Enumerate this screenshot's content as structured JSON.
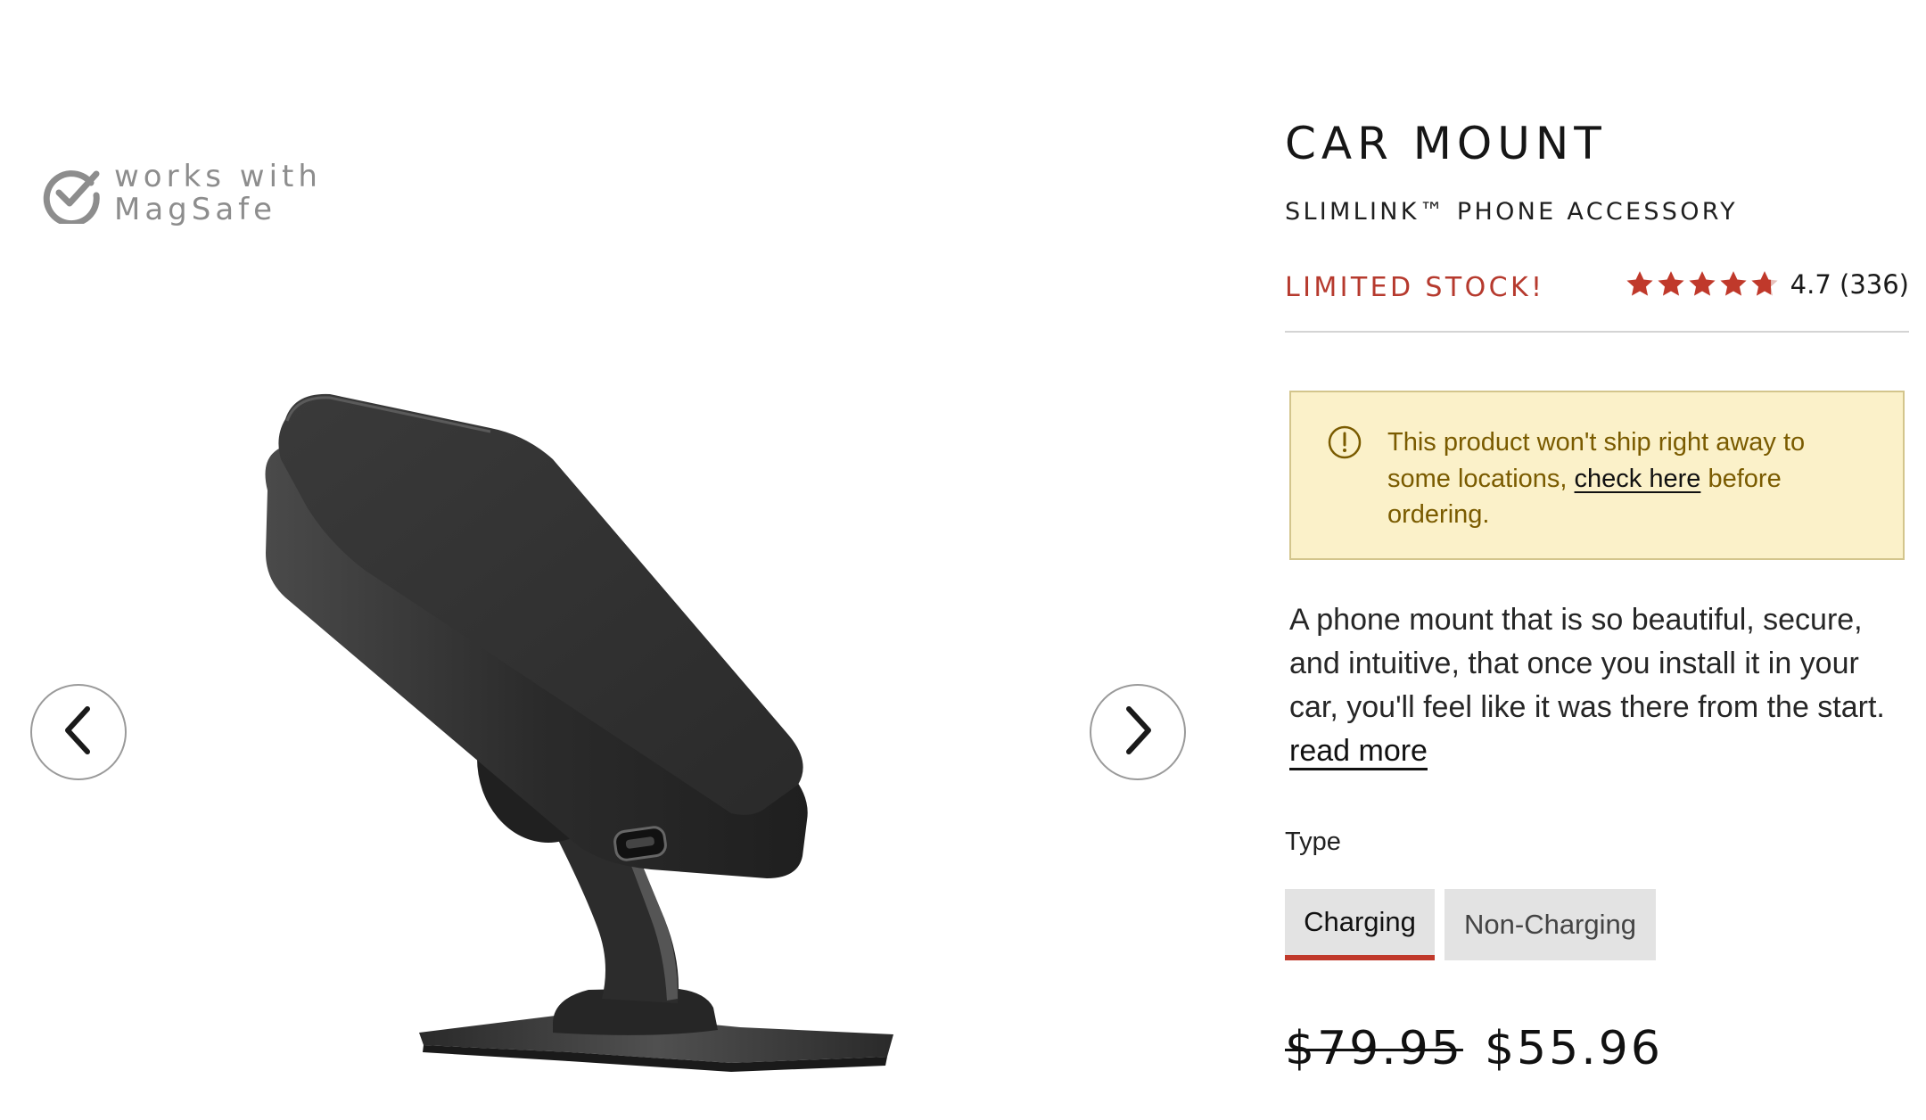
{
  "badge": {
    "line1": "works with",
    "line2": "MagSafe",
    "icon": "check-circle-icon"
  },
  "gallery": {
    "prev_icon": "chevron-left-icon",
    "next_icon": "chevron-right-icon",
    "image": "car-mount-product-image"
  },
  "product": {
    "title": "CAR MOUNT",
    "subtitle": "SLIMLINK™ PHONE ACCESSORY",
    "stock_status": "LIMITED STOCK!",
    "rating": {
      "value": 4.7,
      "max": 5,
      "text": "4.7 (336)",
      "star_color": "#c0392b"
    },
    "notice": {
      "icon": "alert-circle-icon",
      "text_before": "This product won't ship right away to some locations, ",
      "link": "check here",
      "text_after": " before ordering."
    },
    "description": {
      "text": "A phone mount that is so beautiful, secure, and intuitive, that once you install it in your car, you'll feel like it was there from the start.",
      "read_more": "read more"
    },
    "type": {
      "label": "Type",
      "options": [
        {
          "label": "Charging",
          "selected": true
        },
        {
          "label": "Non-Charging",
          "selected": false
        }
      ]
    },
    "price": {
      "original": "$79.95",
      "sale": "$55.96"
    }
  },
  "colors": {
    "accent": "#c0392b",
    "stock": "#b63a2e",
    "notice_bg": "#fbf1c9",
    "notice_text": "#7a5b00"
  }
}
